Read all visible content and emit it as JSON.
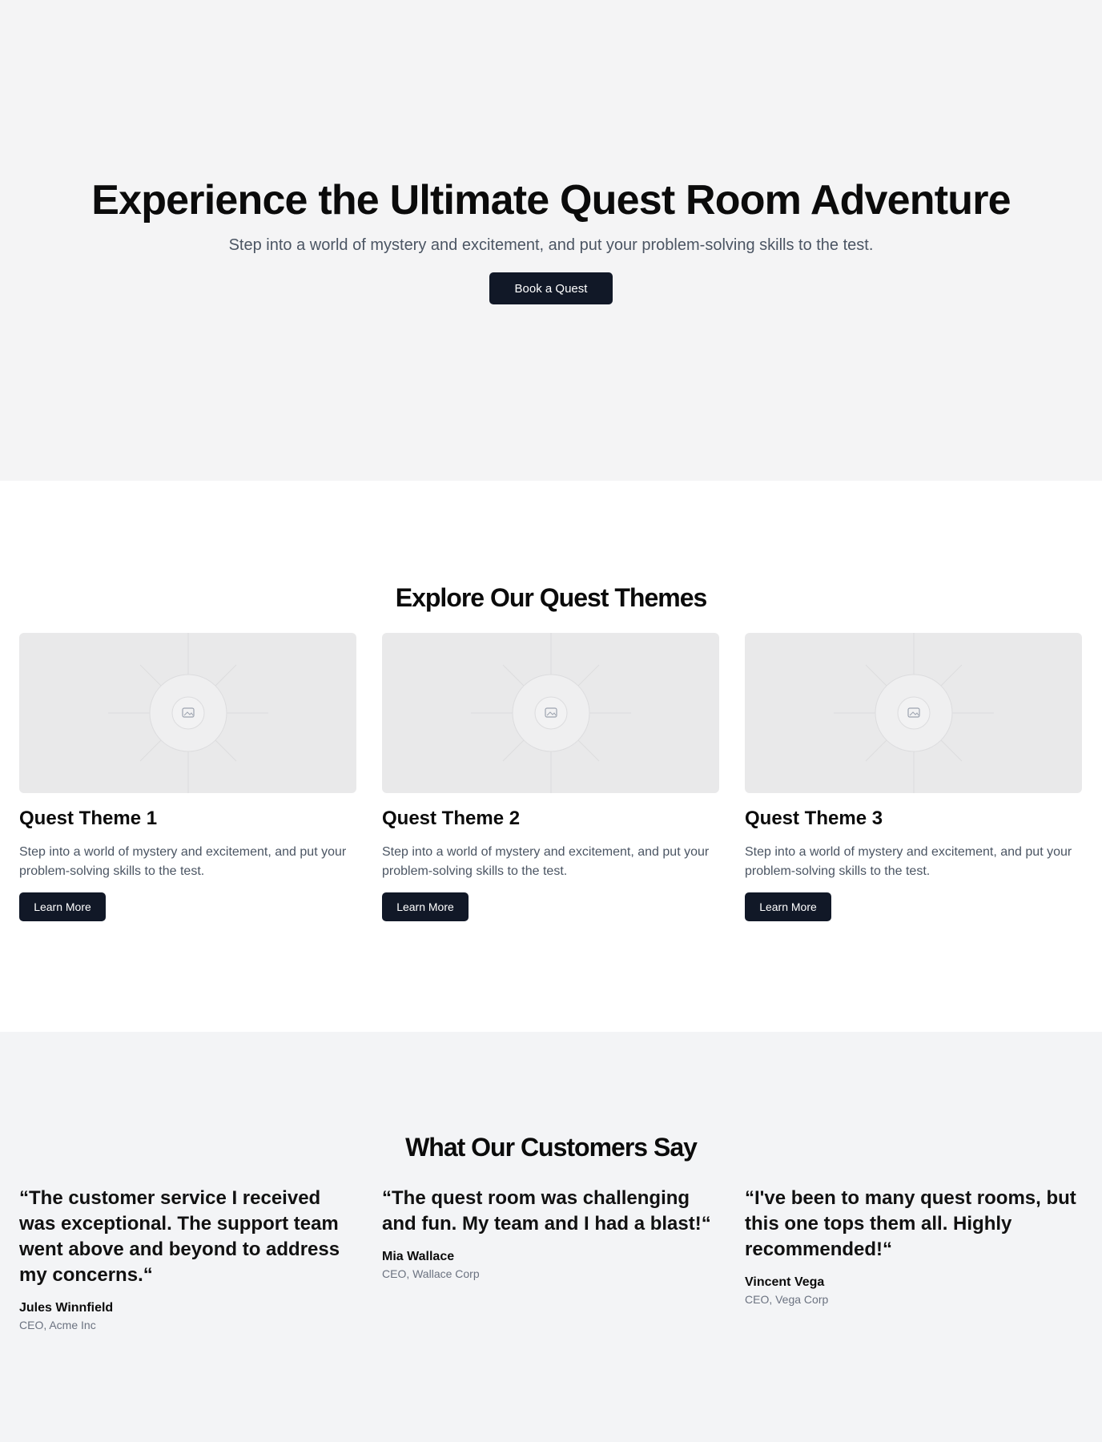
{
  "hero": {
    "title": "Experience the Ultimate Quest Room Adventure",
    "subtitle": "Step into a world of mystery and excitement, and put your problem-solving skills to the test.",
    "cta_label": "Book a Quest"
  },
  "themes": {
    "title": "Explore Our Quest Themes",
    "items": [
      {
        "title": "Quest Theme 1",
        "description": "Step into a world of mystery and excitement, and put your problem-solving skills to the test.",
        "button_label": "Learn More",
        "image_icon": "image-placeholder-icon"
      },
      {
        "title": "Quest Theme 2",
        "description": "Step into a world of mystery and excitement, and put your problem-solving skills to the test.",
        "button_label": "Learn More",
        "image_icon": "image-placeholder-icon"
      },
      {
        "title": "Quest Theme 3",
        "description": "Step into a world of mystery and excitement, and put your problem-solving skills to the test.",
        "button_label": "Learn More",
        "image_icon": "image-placeholder-icon"
      }
    ]
  },
  "testimonials": {
    "title": "What Our Customers Say",
    "items": [
      {
        "quote": "“The customer service I received was exceptional. The support team went above and beyond to address my concerns.“",
        "name": "Jules Winnfield",
        "role": "CEO, Acme Inc"
      },
      {
        "quote": "“The quest room was challenging and fun. My team and I had a blast!“",
        "name": "Mia Wallace",
        "role": "CEO, Wallace Corp"
      },
      {
        "quote": "“I've been to many quest rooms, but this one tops them all. Highly recommended!“",
        "name": "Vincent Vega",
        "role": "CEO, Vega Corp"
      }
    ]
  },
  "colors": {
    "hero_bg": "#f4f4f5",
    "testimonials_bg": "#f3f4f6",
    "button_bg": "#111827",
    "muted_text": "#4b5563"
  }
}
